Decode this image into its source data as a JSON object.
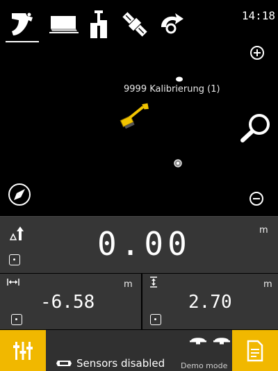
{
  "status": {
    "clock": "14:18"
  },
  "toolbar": {
    "tools": [
      {
        "icon": "bucket-icon",
        "active": true
      },
      {
        "icon": "surface-icon",
        "active": false
      },
      {
        "icon": "mast-icon",
        "active": false
      },
      {
        "icon": "satellite-icon",
        "active": false
      },
      {
        "icon": "sync-icon",
        "active": false
      }
    ]
  },
  "map": {
    "point_label": "9999 Kalibrierung (1)",
    "zoom_in_icon": "zoom-in-icon",
    "zoom_out_icon": "zoom-out-icon",
    "search_icon": "magnifier-icon",
    "compass_icon": "compass-icon"
  },
  "main_readout": {
    "value": "0.00",
    "unit": "m",
    "icon": "delta-height-icon"
  },
  "left_readout": {
    "value": "-6.58",
    "unit": "m",
    "icon": "horizontal-distance-icon"
  },
  "right_readout": {
    "value": "2.70",
    "unit": "m",
    "icon": "vertical-distance-icon"
  },
  "bottom": {
    "sensors_status": "Sensors disabled",
    "mode": "Demo mode",
    "left_button_icon": "adjust-sliders-icon",
    "right_button_icon": "document-icon"
  },
  "colors": {
    "accent": "#f1b800",
    "panel": "#363636",
    "map_bg": "#000000"
  }
}
